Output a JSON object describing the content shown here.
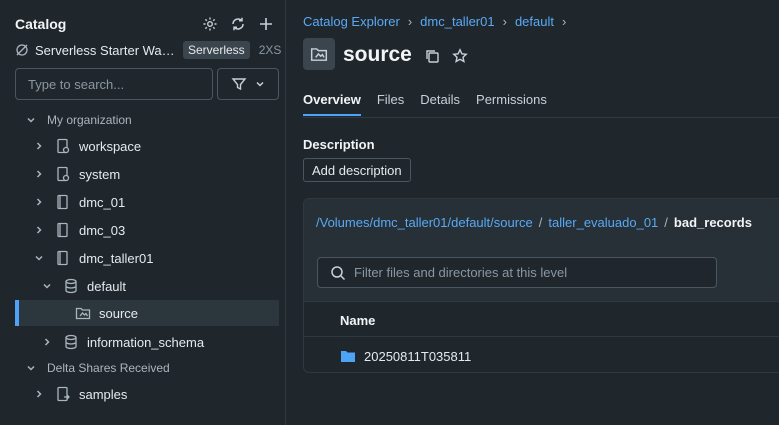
{
  "sidebar": {
    "title": "Catalog",
    "warehouse": {
      "name": "Serverless Starter Wareh...",
      "badge": "Serverless",
      "size": "2XS"
    },
    "search_placeholder": "Type to search...",
    "tree": [
      {
        "label": "My organization",
        "kind": "section",
        "expanded": true
      },
      {
        "label": "workspace",
        "kind": "catalog",
        "expanded": false
      },
      {
        "label": "system",
        "kind": "catalog",
        "expanded": false
      },
      {
        "label": "dmc_01",
        "kind": "catalog",
        "expanded": false
      },
      {
        "label": "dmc_03",
        "kind": "catalog",
        "expanded": false
      },
      {
        "label": "dmc_taller01",
        "kind": "catalog",
        "expanded": true
      },
      {
        "label": "default",
        "kind": "schema",
        "expanded": true
      },
      {
        "label": "source",
        "kind": "volume",
        "selected": true
      },
      {
        "label": "information_schema",
        "kind": "schema",
        "expanded": false
      },
      {
        "label": "Delta Shares Received",
        "kind": "section",
        "expanded": true
      },
      {
        "label": "samples",
        "kind": "catalog",
        "expanded": false
      }
    ]
  },
  "breadcrumb": [
    "Catalog Explorer",
    "dmc_taller01",
    "default"
  ],
  "page": {
    "title": "source",
    "tabs": [
      "Overview",
      "Files",
      "Details",
      "Permissions"
    ],
    "active_tab": "Overview",
    "description_label": "Description",
    "add_description_label": "Add description"
  },
  "files": {
    "path_links": [
      "/Volumes/dmc_taller01/default/source",
      "taller_evaluado_01"
    ],
    "path_current": "bad_records",
    "filter_placeholder": "Filter files and directories at this level",
    "column_name": "Name",
    "rows": [
      "20250811T035811"
    ]
  },
  "colors": {
    "accent": "#4fa3f7",
    "link": "#5aa9f5",
    "background": "#1f272d"
  }
}
